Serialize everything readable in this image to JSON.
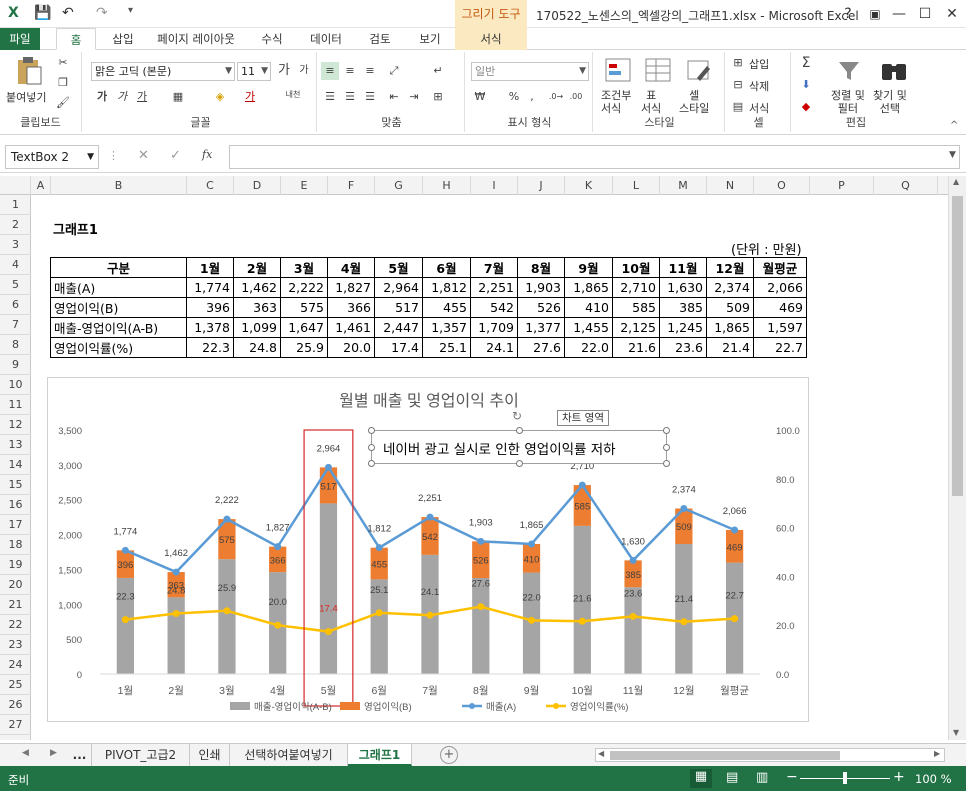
{
  "window": {
    "title": "170522_노센스의_엑셀강의_그래프1.xlsx - Microsoft Excel",
    "context_tab_group": "그리기 도구",
    "buttons": [
      "?",
      "▣",
      "—",
      "☐",
      "✕"
    ]
  },
  "tabs": {
    "file": "파일",
    "home": "홈",
    "insert": "삽입",
    "layout": "페이지 레이아웃",
    "formulas": "수식",
    "data": "데이터",
    "review": "검토",
    "view": "보기",
    "format": "서식"
  },
  "ribbon": {
    "clipboard": {
      "label": "클립보드",
      "paste": "붙여넣기"
    },
    "font": {
      "label": "글꼴",
      "font_name": "맑은 고딕 (본문)",
      "font_size": "11",
      "bold": "가",
      "italic": "가",
      "underline": "가",
      "phonetic": "내천"
    },
    "alignment": {
      "label": "맞춤"
    },
    "number": {
      "label": "표시 형식",
      "format": "일반",
      "percent": "%",
      "comma": ","
    },
    "styles": {
      "label": "스타일",
      "conditional": "조건부\n서식",
      "table": "표\n서식",
      "cell": "셀\n스타일"
    },
    "cells": {
      "label": "셀",
      "insert": "삽입",
      "delete": "삭제",
      "format": "서식"
    },
    "editing": {
      "label": "편집",
      "sort": "정렬 및\n필터",
      "find": "찾기 및\n선택"
    }
  },
  "formula_bar": {
    "name_box": "TextBox 2",
    "formula": ""
  },
  "columns": [
    "A",
    "B",
    "C",
    "D",
    "E",
    "F",
    "G",
    "H",
    "I",
    "J",
    "K",
    "L",
    "M",
    "N",
    "O",
    "P",
    "Q"
  ],
  "rows": [
    "1",
    "2",
    "3",
    "4",
    "5",
    "6",
    "7",
    "8",
    "9",
    "10",
    "11",
    "12",
    "13",
    "14",
    "15",
    "16",
    "17",
    "18",
    "19",
    "20",
    "21",
    "22",
    "23",
    "24",
    "25",
    "26",
    "27"
  ],
  "sheet": {
    "title": "그래프1",
    "unit": "(단위 : 만원)",
    "table": {
      "headers": [
        "구분",
        "1월",
        "2월",
        "3월",
        "4월",
        "5월",
        "6월",
        "7월",
        "8월",
        "9월",
        "10월",
        "11월",
        "12월",
        "월평균"
      ],
      "rows": [
        [
          "매출(A)",
          "1,774",
          "1,462",
          "2,222",
          "1,827",
          "2,964",
          "1,812",
          "2,251",
          "1,903",
          "1,865",
          "2,710",
          "1,630",
          "2,374",
          "2,066"
        ],
        [
          "영업이익(B)",
          "396",
          "363",
          "575",
          "366",
          "517",
          "455",
          "542",
          "526",
          "410",
          "585",
          "385",
          "509",
          "469"
        ],
        [
          "매출-영업이익(A-B)",
          "1,378",
          "1,099",
          "1,647",
          "1,461",
          "2,447",
          "1,357",
          "1,709",
          "1,377",
          "1,455",
          "2,125",
          "1,245",
          "1,865",
          "1,597"
        ],
        [
          "영업이익률(%)",
          "22.3",
          "24.8",
          "25.9",
          "20.0",
          "17.4",
          "25.1",
          "24.1",
          "27.6",
          "22.0",
          "21.6",
          "23.6",
          "21.4",
          "22.7"
        ]
      ]
    }
  },
  "textbox": {
    "text": "네이버 광고 실시로 인한 영업이익률 저하",
    "tooltip": "차트 영역"
  },
  "chart_data": {
    "type": "bar",
    "title": "월별 매출 및 영업이익 추이",
    "categories": [
      "1월",
      "2월",
      "3월",
      "4월",
      "5월",
      "6월",
      "7월",
      "8월",
      "9월",
      "10월",
      "11월",
      "12월",
      "월평균"
    ],
    "series": [
      {
        "name": "매출-영업이익(A-B)",
        "type": "stacked-bar",
        "axis": "left",
        "color": "#a5a5a5",
        "values": [
          1378,
          1099,
          1647,
          1461,
          2447,
          1357,
          1709,
          1377,
          1455,
          2125,
          1245,
          1865,
          1597
        ]
      },
      {
        "name": "영업이익(B)",
        "type": "stacked-bar",
        "axis": "left",
        "color": "#ed7d31",
        "values": [
          396,
          363,
          575,
          366,
          517,
          455,
          542,
          526,
          410,
          585,
          385,
          509,
          469
        ]
      },
      {
        "name": "매출(A)",
        "type": "line",
        "axis": "left",
        "color": "#5b9bd5",
        "values": [
          1774,
          1462,
          2222,
          1827,
          2964,
          1812,
          2251,
          1903,
          1865,
          2710,
          1630,
          2374,
          2066
        ]
      },
      {
        "name": "영업이익률(%)",
        "type": "line",
        "axis": "right",
        "color": "#ffc000",
        "values": [
          22.3,
          24.8,
          25.9,
          20.0,
          17.4,
          25.1,
          24.1,
          27.6,
          22.0,
          21.6,
          23.6,
          21.4,
          22.7
        ]
      }
    ],
    "y_left": {
      "min": 0,
      "max": 3500,
      "ticks": [
        "0",
        "500",
        "1,000",
        "1,500",
        "2,000",
        "2,500",
        "3,000",
        "3,500"
      ]
    },
    "y_right": {
      "min": 0,
      "max": 100,
      "ticks": [
        "0.0",
        "20.0",
        "40.0",
        "60.0",
        "80.0",
        "100.0"
      ]
    },
    "sales_labels": [
      "1,774",
      "1,462",
      "2,222",
      "1,827",
      "2,964",
      "1,812",
      "2,251",
      "1,903",
      "1,865",
      "2,710",
      "1,630",
      "2,374",
      "2,066"
    ],
    "rate_labels": [
      "22.3",
      "24.8",
      "25.9",
      "20.0",
      "17.4",
      "25.1",
      "24.1",
      "27.6",
      "22.0",
      "21.6",
      "23.6",
      "21.4",
      "22.7"
    ],
    "highlight_index": 4,
    "highlight_color": "#d62728",
    "legend": "bottom",
    "legend_labels": [
      "매출-영업이익(A-B)",
      "영업이익(B)",
      "매출(A)",
      "영업이익률(%)"
    ],
    "grid": false
  },
  "sheet_tabs": [
    "...",
    "PIVOT_고급2",
    "인쇄",
    "선택하여붙여넣기",
    "그래프1"
  ],
  "active_sheet": "그래프1",
  "status": {
    "ready": "준비",
    "zoom": "100 %"
  }
}
